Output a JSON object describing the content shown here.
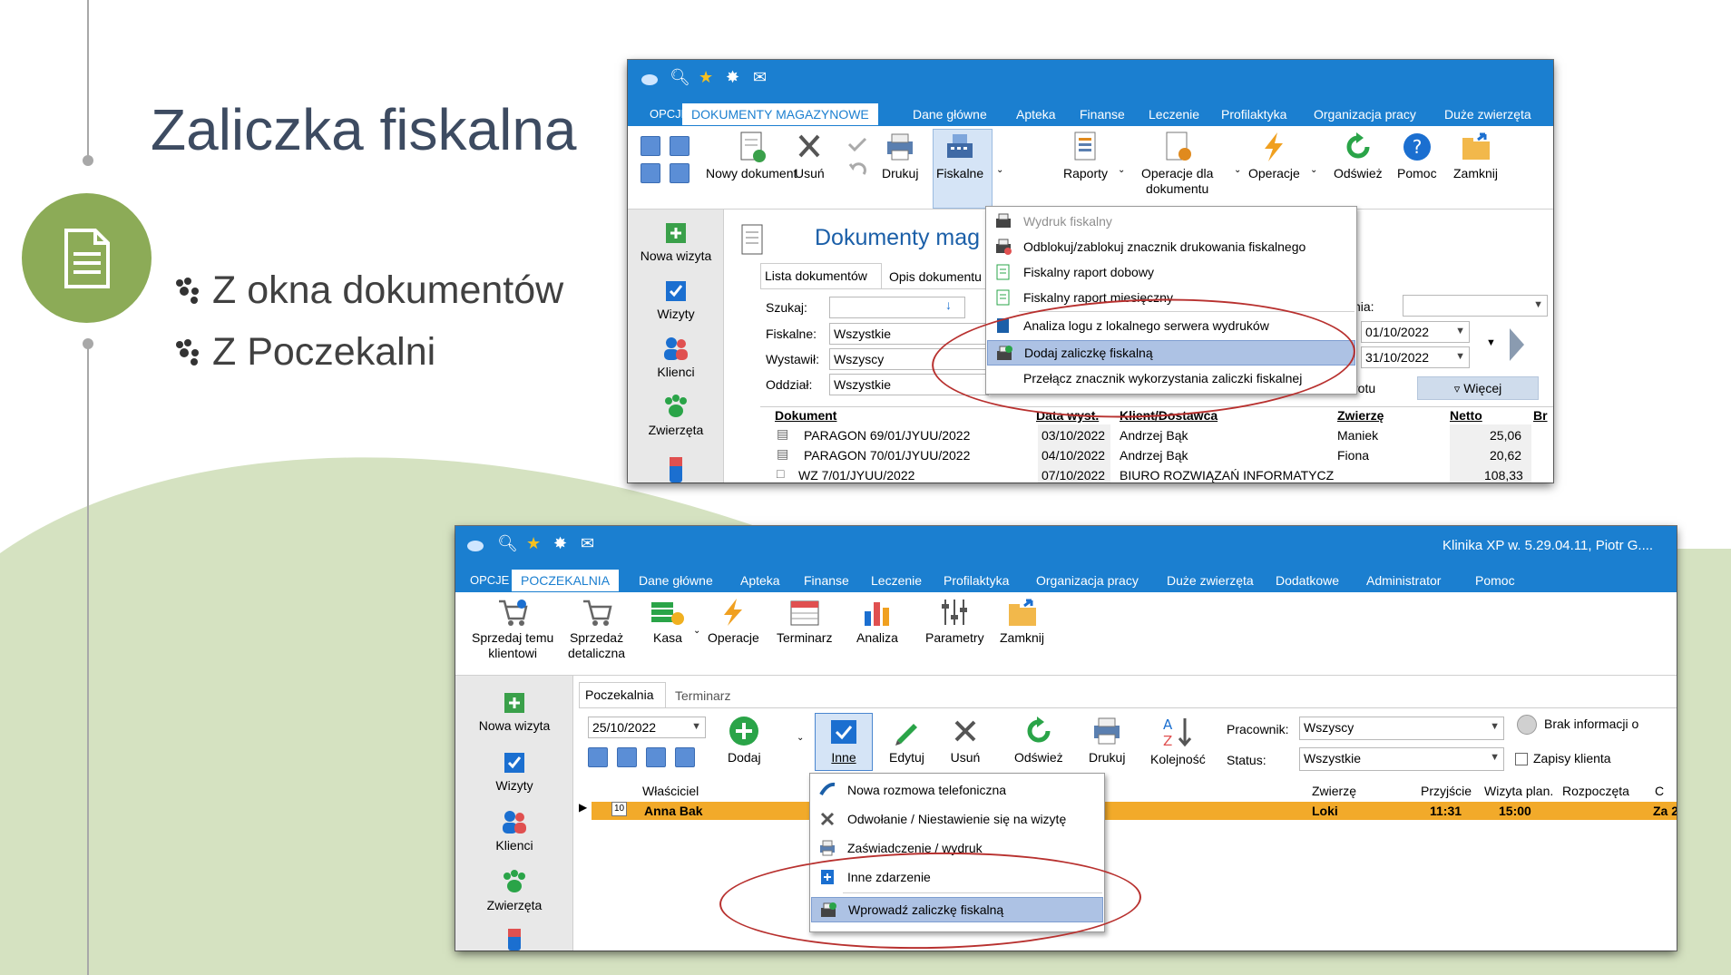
{
  "slide": {
    "title": "Zaliczka fiskalna",
    "bullets": [
      "Z okna dokumentów",
      "Z Poczekalni"
    ],
    "colors": {
      "green": "#8cab57",
      "light_green": "#d5e2c1",
      "ribbon_blue": "#1b7fd0",
      "highlight": "#adc2e4",
      "ellipse": "#b8312f"
    }
  },
  "win1": {
    "menu": {
      "opcje": "OPCJE",
      "tabs": [
        "DOKUMENTY MAGAZYNOWE",
        "Dane główne",
        "Apteka",
        "Finanse",
        "Leczenie",
        "Profilaktyka",
        "Organizacja pracy",
        "Duże zwierzęta"
      ]
    },
    "ribbon": {
      "nowy": "Nowy dokument",
      "usun": "Usuń",
      "drukuj": "Drukuj",
      "fiskalne": "Fiskalne",
      "raporty": "Raporty",
      "operacje_dla": "Operacje dla",
      "dokumentu": "dokumentu",
      "operacje": "Operacje",
      "odswiez": "Odśwież",
      "pomoc": "Pomoc",
      "zamknij": "Zamknij"
    },
    "sidebar": [
      "Nowa wizyta",
      "Wizyty",
      "Klienci",
      "Zwierzęta"
    ],
    "heading": "Dokumenty mag",
    "tabs": [
      "Lista dokumentów",
      "Opis dokumentu"
    ],
    "filters": {
      "szukaj": "Szukaj:",
      "fiskalne": "Fiskalne:",
      "fiskalne_val": "Wszystkie",
      "wystawil": "Wystawił:",
      "wystawil_val": "Wszyscy",
      "oddzial": "Oddział:",
      "oddzial_val": "Wszystkie",
      "nia": "nia:",
      "date_from": "01/10/2022",
      "date_to": "31/10/2022",
      "rotu": "rotu",
      "wiecej": "Więcej"
    },
    "columns": [
      "Dokument",
      "Data wyst.",
      "Klient/Dostawca",
      "Zwierzę",
      "Netto",
      "Br"
    ],
    "rows": [
      {
        "doc": "PARAGON 69/01/JYUU/2022",
        "date": "03/10/2022",
        "client": "Andrzej Bąk",
        "animal": "Maniek",
        "netto": "25,06"
      },
      {
        "doc": "PARAGON 70/01/JYUU/2022",
        "date": "04/10/2022",
        "client": "Andrzej Bąk",
        "animal": "Fiona",
        "netto": "20,62"
      },
      {
        "doc": "WZ 7/01/JYUU/2022",
        "date": "07/10/2022",
        "client": "BIURO ROZWIĄZAŃ INFORMATYCZ",
        "animal": "",
        "netto": "108,33"
      }
    ],
    "dropdown": [
      "Wydruk fiskalny",
      "Odblokuj/zablokuj znacznik drukowania fiskalnego",
      "Fiskalny raport dobowy",
      "Fiskalny raport miesięczny",
      "Analiza logu z lokalnego serwera wydruków",
      "Dodaj zaliczkę fiskalną",
      "Przełącz znacznik wykorzystania zaliczki fiskalnej"
    ]
  },
  "win2": {
    "app_title": "Klinika XP w. 5.29.04.11, Piotr G....",
    "menu": {
      "opcje": "OPCJE",
      "tabs": [
        "POCZEKALNIA",
        "Dane główne",
        "Apteka",
        "Finanse",
        "Leczenie",
        "Profilaktyka",
        "Organizacja pracy",
        "Duże zwierzęta",
        "Dodatkowe",
        "Administrator",
        "Pomoc"
      ]
    },
    "ribbon": {
      "sprzedaj1": "Sprzedaj temu",
      "sprzedaj2": "klientowi",
      "sprzedaz1": "Sprzedaż",
      "sprzedaz2": "detaliczna",
      "kasa": "Kasa",
      "operacje": "Operacje",
      "terminarz": "Terminarz",
      "analiza": "Analiza",
      "parametry": "Parametry",
      "zamknij": "Zamknij"
    },
    "sidebar": [
      "Nowa wizyta",
      "Wizyty",
      "Klienci",
      "Zwierzęta"
    ],
    "tabs": [
      "Poczekalnia",
      "Terminarz"
    ],
    "toolbar": {
      "date": "25/10/2022",
      "dodaj": "Dodaj",
      "inne": "Inne",
      "edytuj": "Edytuj",
      "usun": "Usuń",
      "odswiez": "Odśwież",
      "drukuj": "Drukuj",
      "kolejnosc": "Kolejność",
      "pracownik": "Pracownik:",
      "pracownik_val": "Wszyscy",
      "status": "Status:",
      "status_val": "Wszystkie",
      "brak": "Brak informacji o",
      "zapisy": "Zapisy klienta"
    },
    "columns": [
      "Właściciel",
      "Zwierzę",
      "Przyjście",
      "Wizyta plan.",
      "Rozpoczęta",
      "C"
    ],
    "row": {
      "owner": "Anna Bak",
      "animal": "Loki",
      "arrival": "11:31",
      "planned": "15:00",
      "extra": "Za 2",
      "day": "10"
    },
    "dropdown": [
      "Nowa rozmowa telefoniczna",
      "Odwołanie / Niestawienie się na wizytę",
      "Zaświadczenie / wydruk",
      "Inne zdarzenie",
      "Wprowadź zaliczkę fiskalną"
    ]
  }
}
